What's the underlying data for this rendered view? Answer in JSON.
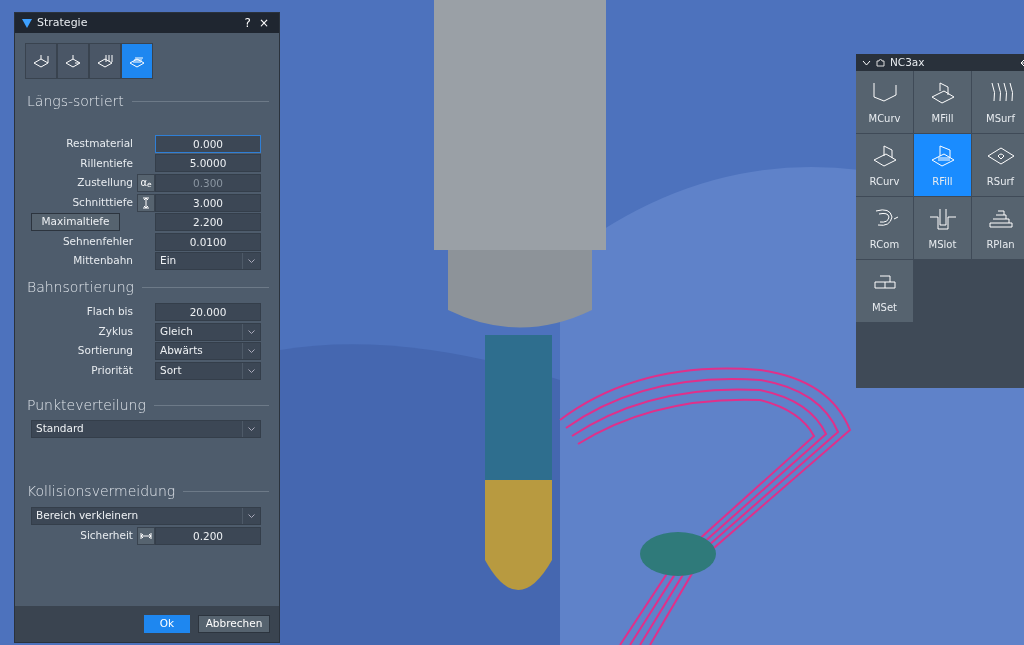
{
  "window": {
    "title": "Strategie",
    "buttons": [
      "?",
      "×"
    ]
  },
  "strategy_tabs": [
    {
      "selected": false
    },
    {
      "selected": false
    },
    {
      "selected": false
    },
    {
      "selected": true
    }
  ],
  "sections": [
    {
      "title": "Längs-sortiert",
      "rows": [
        {
          "kind": "input",
          "label": "Restmaterial",
          "value": "0.000",
          "focused": true,
          "disabled": false
        },
        {
          "kind": "input",
          "label": "Rillentiefe",
          "value": "5.0000",
          "focused": false,
          "disabled": false
        },
        {
          "kind": "input",
          "label": "Zustellung",
          "addon": {
            "kind": "text",
            "text": "α$_{e}$"
          },
          "value": "0.300",
          "focused": false,
          "disabled": true
        },
        {
          "kind": "input",
          "label": "Schnitttiefe",
          "addon": {
            "kind": "depth"
          },
          "value": "3.000",
          "focused": false,
          "disabled": false
        },
        {
          "kind": "button-input",
          "label": "Maximaltiefe",
          "value": "2.200",
          "focused": false,
          "disabled": false
        },
        {
          "kind": "input",
          "label": "Sehnenfehler",
          "value": "0.0100",
          "focused": false,
          "disabled": false
        },
        {
          "kind": "select",
          "label": "Mittenbahn",
          "value": "Ein"
        }
      ]
    },
    {
      "title": "Bahnsortierung",
      "rows": [
        {
          "kind": "input",
          "label": "Flach bis",
          "value": "20.000",
          "focused": false,
          "disabled": false
        },
        {
          "kind": "select",
          "label": "Zyklus",
          "value": "Gleich"
        },
        {
          "kind": "select",
          "label": "Sortierung",
          "value": "Abwärts"
        },
        {
          "kind": "select",
          "label": "Priorität",
          "value": "Sort"
        }
      ]
    },
    {
      "title": "Punkteverteilung",
      "rows": [
        {
          "kind": "wide-select",
          "value": "Standard"
        }
      ]
    },
    {
      "title": "Kollisionsvermeidung",
      "rows": [
        {
          "kind": "wide-select",
          "value": "Bereich verkleinern"
        },
        {
          "kind": "input",
          "label": "Sicherheit",
          "addon": {
            "kind": "width"
          },
          "value": "0.200",
          "focused": false,
          "disabled": false
        }
      ]
    }
  ],
  "footer_buttons": [
    {
      "label": "Ok",
      "kind": "primary"
    },
    {
      "label": "Abbrechen",
      "kind": "secondary"
    }
  ],
  "panel": {
    "title": "NC3ax",
    "tiles": [
      {
        "label": "MCurv",
        "selected": false
      },
      {
        "label": "MFill",
        "selected": false
      },
      {
        "label": "MSurf",
        "selected": false
      },
      {
        "label": "RCurv",
        "selected": false
      },
      {
        "label": "RFill",
        "selected": true
      },
      {
        "label": "RSurf",
        "selected": false
      },
      {
        "label": "RCom",
        "selected": false
      },
      {
        "label": "MSlot",
        "selected": false
      },
      {
        "label": "RPlan",
        "selected": false
      },
      {
        "label": "MSet",
        "selected": false
      }
    ]
  }
}
